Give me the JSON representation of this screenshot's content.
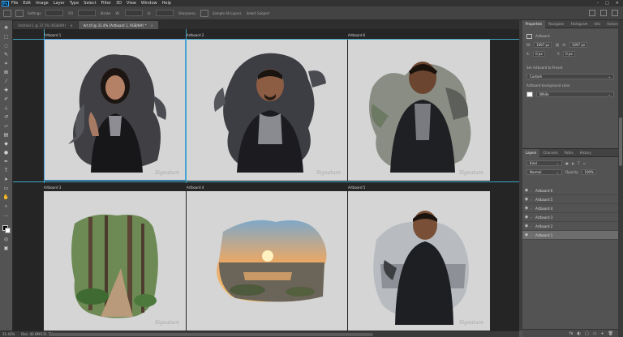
{
  "app": {
    "logo": "Ps"
  },
  "menu": [
    "File",
    "Edit",
    "Image",
    "Layer",
    "Type",
    "Select",
    "Filter",
    "3D",
    "View",
    "Window",
    "Help"
  ],
  "window_controls": [
    "–",
    "□",
    "✕"
  ],
  "options": {
    "labels": [
      "Settings",
      "Fill",
      "Stroke",
      "W:",
      "H:",
      "Sharpness",
      "Sample All Layers",
      "Select Subject"
    ]
  },
  "tabs": [
    {
      "label": "Untitled-1 @ 37.5% (RGB/8#)",
      "active": false
    },
    {
      "label": "Art.tif @ 31.4% (Artboard 1, RGB/8#) *",
      "active": true
    }
  ],
  "artboards": [
    {
      "label": "Artboard 1",
      "content": "woman"
    },
    {
      "label": "Artboard 2",
      "content": "man"
    },
    {
      "label": "Artboard 6",
      "content": "boy"
    },
    {
      "label": "Artboard 3",
      "content": "forest"
    },
    {
      "label": "Artboard 4",
      "content": "sunset"
    },
    {
      "label": "Artboard 5",
      "content": "boy-jacket"
    }
  ],
  "signature": "Signature",
  "status": {
    "zoom": "31.43%",
    "doc": "Doc: 42.6M/131.7M"
  },
  "properties": {
    "tabs": [
      "Properties",
      "Navigator",
      "Histogram",
      "Info",
      "Actions"
    ],
    "title": "Artboard",
    "w_label": "W:",
    "w_value": "1097 px",
    "h_label": "H:",
    "h_value": "1097 px",
    "x_label": "X:",
    "x_value": "0 px",
    "y_label": "Y:",
    "y_value": "0 px",
    "preset_label": "Set Artboard to Preset",
    "preset_value": "Custom",
    "bg_label": "Artboard background color",
    "bg_value": "White"
  },
  "layers": {
    "tabs": [
      "Layers",
      "Channels",
      "Paths",
      "History"
    ],
    "kind": "Kind",
    "mode": "Normal",
    "opacity_label": "Opacity:",
    "opacity": "100%",
    "items": [
      {
        "name": "Artboard 6",
        "selected": false
      },
      {
        "name": "Artboard 5",
        "selected": false
      },
      {
        "name": "Artboard 4",
        "selected": false
      },
      {
        "name": "Artboard 3",
        "selected": false
      },
      {
        "name": "Artboard 2",
        "selected": false
      },
      {
        "name": "Artboard 1",
        "selected": true
      }
    ],
    "bottom_icons": [
      "fx",
      "◐",
      "▢",
      "▭",
      "+",
      "🗑"
    ]
  },
  "colors": {
    "accent": "#31a8ff",
    "guide": "#3aa5c4",
    "canvas": "#252525",
    "artboard": "#d5d5d5"
  }
}
